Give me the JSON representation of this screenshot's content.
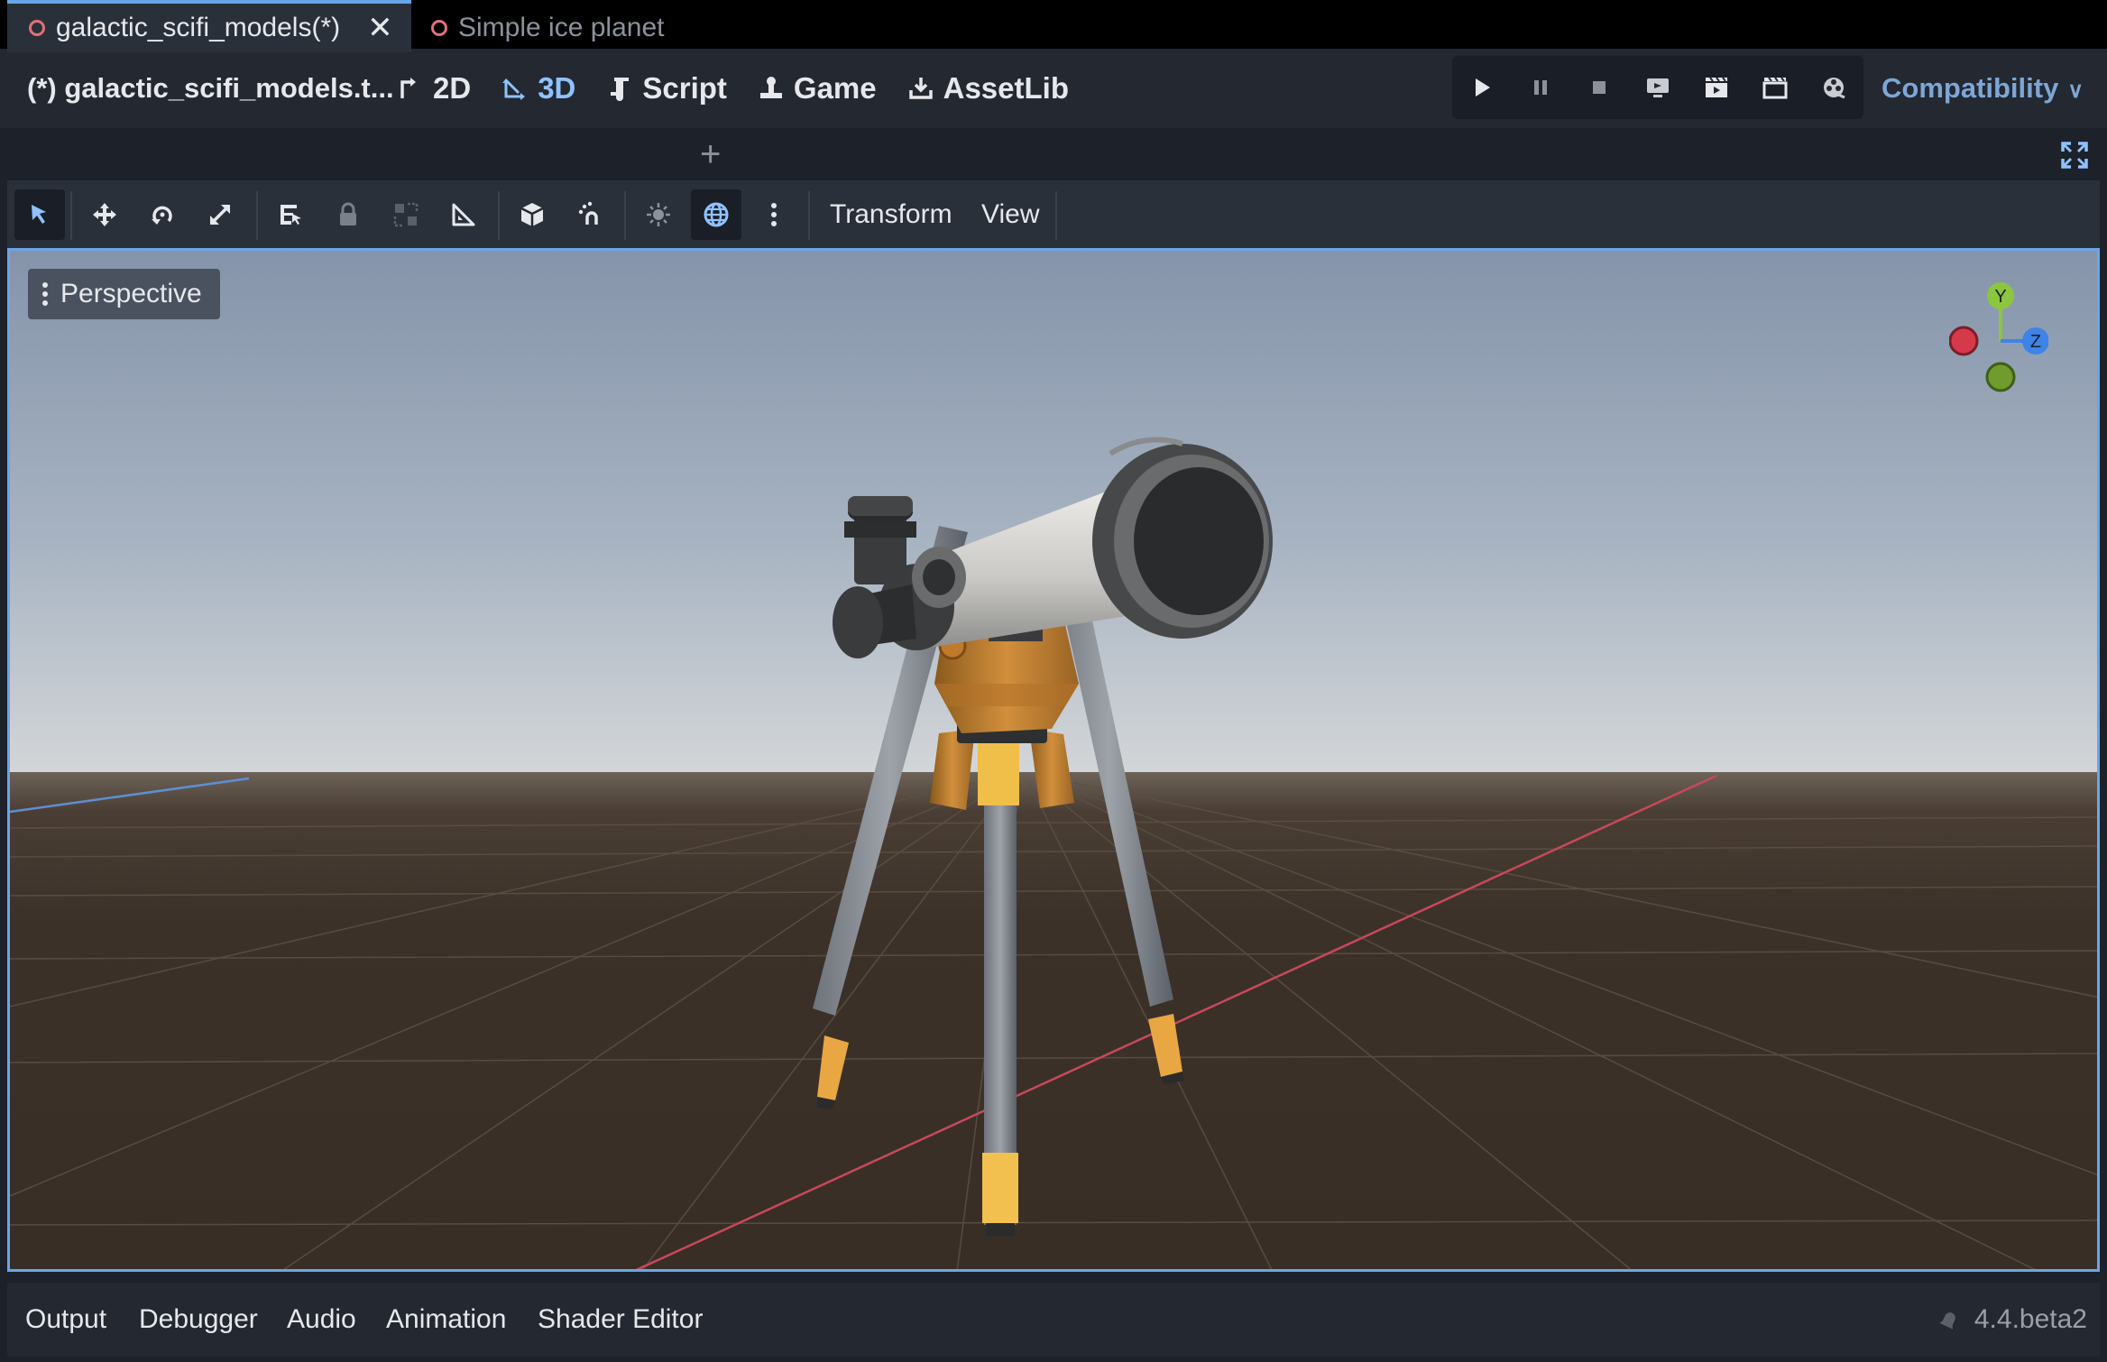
{
  "menubar": {
    "scene_title": "(*) galactic_scifi_models.t...",
    "modes": [
      {
        "label": "2D",
        "icon": "2d-icon",
        "active": false
      },
      {
        "label": "3D",
        "icon": "3d-icon",
        "active": true
      },
      {
        "label": "Script",
        "icon": "script-icon",
        "active": false
      },
      {
        "label": "Game",
        "icon": "game-icon",
        "active": false
      },
      {
        "label": "AssetLib",
        "icon": "assetlib-icon",
        "active": false
      }
    ],
    "run_buttons": [
      "play-icon",
      "pause-icon",
      "stop-icon",
      "remote-debug-icon",
      "play-scene-icon",
      "play-custom-scene-icon",
      "movie-maker-icon"
    ],
    "renderer": "Compatibility"
  },
  "tabs": [
    {
      "label": "galactic_scifi_models(*)",
      "active": true
    },
    {
      "label": "Simple ice planet",
      "active": false
    }
  ],
  "toolbar": {
    "transform_menu": "Transform",
    "view_menu": "View"
  },
  "viewport": {
    "perspective_label": "Perspective",
    "gizmo": {
      "y": "Y",
      "z": "Z"
    }
  },
  "bottom_panel": {
    "tabs": [
      "Output",
      "Debugger",
      "Audio",
      "Animation",
      "Shader Editor"
    ],
    "version": "4.4.beta2"
  },
  "colors": {
    "accent": "#6aa5e8",
    "axis_x": "#d63a4a",
    "axis_y": "#8cc63f",
    "axis_z": "#3d84e8"
  }
}
